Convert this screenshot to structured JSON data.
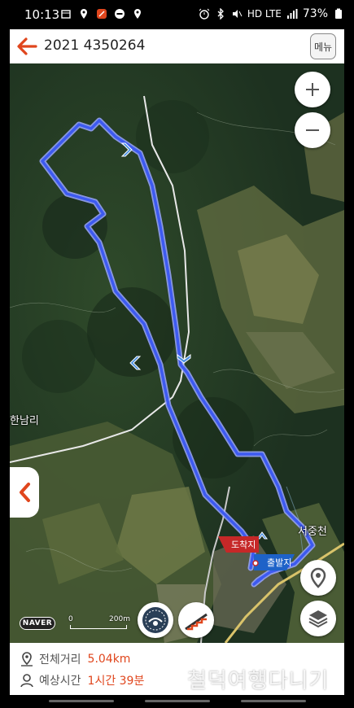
{
  "status_bar": {
    "time": "10:13",
    "network": "HD LTE",
    "battery": "73%"
  },
  "header": {
    "title": "2021 4350264",
    "menu_label": "메뉴",
    "back_icon": "back-arrow-icon"
  },
  "map": {
    "place_label_1": "한남리",
    "place_label_2": "서중천",
    "start_label": "출발지",
    "end_label": "도착지",
    "logo": "NAVER",
    "scale_start": "0",
    "scale_distance": "200m",
    "colors": {
      "route": "#3d5af1",
      "start_flag": "#1e62c8",
      "end_flag": "#c62828",
      "accent": "#e0461d"
    }
  },
  "info": {
    "distance_label": "전체거리",
    "distance_value": "5.04km",
    "time_label": "예상시간",
    "time_value": "1시간 39분"
  },
  "watermark": "철덕여행다니기"
}
